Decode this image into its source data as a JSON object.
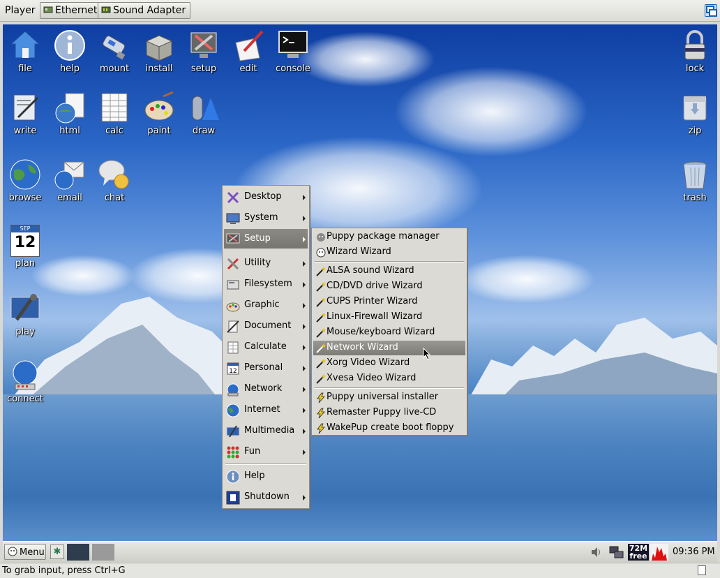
{
  "player": {
    "menu_label": "Player",
    "devices": [
      "Ethernet",
      "Sound Adapter"
    ],
    "status_text": "To grab input, press Ctrl+G"
  },
  "desktop": {
    "icons": [
      {
        "label": "file",
        "icon": "home-icon"
      },
      {
        "label": "help",
        "icon": "info-icon"
      },
      {
        "label": "mount",
        "icon": "usb-drive-icon"
      },
      {
        "label": "install",
        "icon": "package-box-icon"
      },
      {
        "label": "setup",
        "icon": "tools-monitor-icon"
      },
      {
        "label": "edit",
        "icon": "pen-paper-icon"
      },
      {
        "label": "console",
        "icon": "terminal-icon"
      },
      {
        "label": "lock",
        "icon": "padlock-icon"
      },
      {
        "label": "write",
        "icon": "writer-icon"
      },
      {
        "label": "html",
        "icon": "globe-document-icon"
      },
      {
        "label": "calc",
        "icon": "spreadsheet-icon"
      },
      {
        "label": "paint",
        "icon": "palette-icon"
      },
      {
        "label": "draw",
        "icon": "shapes-icon"
      },
      {
        "label": "zip",
        "icon": "archive-icon"
      },
      {
        "label": "browse",
        "icon": "globe-icon"
      },
      {
        "label": "email",
        "icon": "envelope-globe-icon"
      },
      {
        "label": "chat",
        "icon": "chat-bubble-icon"
      },
      {
        "label": "trash",
        "icon": "trash-can-icon"
      },
      {
        "label": "plan",
        "icon": "calendar-icon"
      },
      {
        "label": "play",
        "icon": "media-player-icon"
      },
      {
        "label": "connect",
        "icon": "globe-connect-icon"
      }
    ],
    "calendar_month": "SEP",
    "calendar_day": "12"
  },
  "main_menu": {
    "items": [
      {
        "label": "Desktop",
        "icon": "desktop-x-icon",
        "has_submenu": true
      },
      {
        "label": "System",
        "icon": "monitor-icon",
        "has_submenu": true
      },
      {
        "label": "Setup",
        "icon": "setup-tools-icon",
        "has_submenu": true,
        "active": true
      },
      {
        "label": "Utility",
        "icon": "utility-tools-icon",
        "has_submenu": true
      },
      {
        "label": "Filesystem",
        "icon": "filesystem-icon",
        "has_submenu": true
      },
      {
        "label": "Graphic",
        "icon": "graphic-palette-icon",
        "has_submenu": true
      },
      {
        "label": "Document",
        "icon": "document-icon",
        "has_submenu": true
      },
      {
        "label": "Calculate",
        "icon": "calculate-icon",
        "has_submenu": true
      },
      {
        "label": "Personal",
        "icon": "personal-calendar-icon",
        "has_submenu": true
      },
      {
        "label": "Network",
        "icon": "network-globe-icon",
        "has_submenu": true
      },
      {
        "label": "Internet",
        "icon": "internet-globe-icon",
        "has_submenu": true
      },
      {
        "label": "Multimedia",
        "icon": "multimedia-icon",
        "has_submenu": true
      },
      {
        "label": "Fun",
        "icon": "fun-dice-icon",
        "has_submenu": true
      },
      {
        "label": "Help",
        "icon": "help-info-icon",
        "has_submenu": false
      },
      {
        "label": "Shutdown",
        "icon": "shutdown-icon",
        "has_submenu": true
      }
    ]
  },
  "setup_menu": {
    "items": [
      {
        "label": "Puppy package manager",
        "icon": "package-manager-icon"
      },
      {
        "label": "Wizard Wizard",
        "icon": "wizard-wizard-icon"
      },
      {
        "label": "ALSA sound Wizard",
        "icon": "wand-icon"
      },
      {
        "label": "CD/DVD drive Wizard",
        "icon": "wand-icon"
      },
      {
        "label": "CUPS Printer Wizard",
        "icon": "wand-icon"
      },
      {
        "label": "Linux-Firewall Wizard",
        "icon": "wand-icon"
      },
      {
        "label": "Mouse/keyboard Wizard",
        "icon": "wand-icon"
      },
      {
        "label": "Network Wizard",
        "icon": "wand-icon",
        "active": true
      },
      {
        "label": "Xorg Video Wizard",
        "icon": "wand-icon"
      },
      {
        "label": "Xvesa Video Wizard",
        "icon": "wand-icon"
      },
      {
        "label": "Puppy universal installer",
        "icon": "lightning-icon"
      },
      {
        "label": "Remaster Puppy live-CD",
        "icon": "lightning-icon"
      },
      {
        "label": "WakePup create boot floppy",
        "icon": "lightning-icon"
      }
    ]
  },
  "taskbar": {
    "menu_label": "Menu",
    "tray_free_value": "72M",
    "tray_free_label": "free",
    "clock": "09:36 PM"
  },
  "colors": {
    "menu_bg": "#dcdad5",
    "menu_highlight": "#7e7c76",
    "sky_top": "#0e3ea2"
  }
}
